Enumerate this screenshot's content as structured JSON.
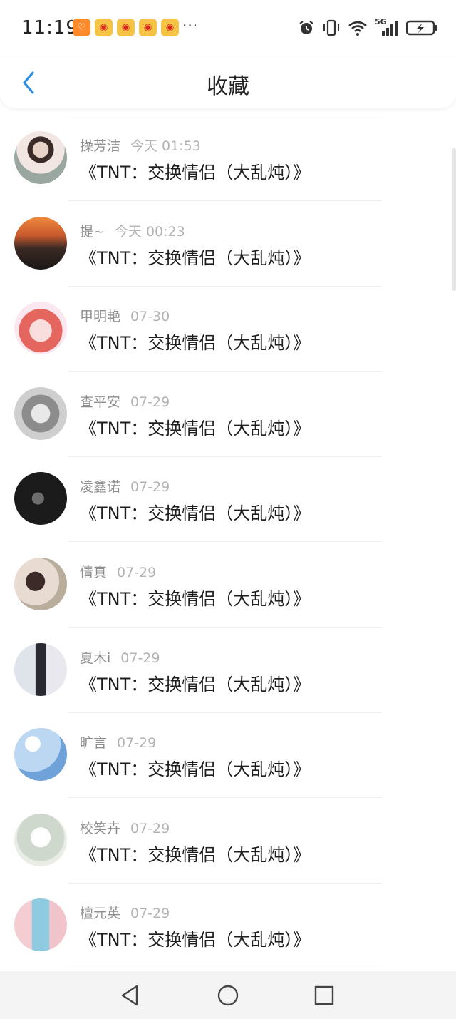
{
  "status_bar": {
    "time": "11:19",
    "network": "5G",
    "apps": [
      "taobao",
      "weibo",
      "weibo",
      "weibo",
      "weibo"
    ],
    "more": "···"
  },
  "header": {
    "title": "收藏",
    "back_icon": "chevron-left-icon",
    "accent_color": "#2b8de6"
  },
  "favorites": [
    {
      "user": "操芳洁",
      "time": "今天 01:53",
      "title": "《TNT：交换情侣（大乱炖）》"
    },
    {
      "user": "提~",
      "time": "今天 00:23",
      "title": "《TNT：交换情侣（大乱炖）》"
    },
    {
      "user": "甲明艳",
      "time": "07-30",
      "title": "《TNT：交换情侣（大乱炖）》"
    },
    {
      "user": "查平安",
      "time": "07-29",
      "title": "《TNT：交换情侣（大乱炖）》"
    },
    {
      "user": "凌鑫诺",
      "time": "07-29",
      "title": "《TNT：交换情侣（大乱炖）》"
    },
    {
      "user": "倩真",
      "time": "07-29",
      "title": "《TNT：交换情侣（大乱炖）》"
    },
    {
      "user": "夏木i",
      "time": "07-29",
      "title": "《TNT：交换情侣（大乱炖）》"
    },
    {
      "user": "旷言",
      "time": "07-29",
      "title": "《TNT：交换情侣（大乱炖）》"
    },
    {
      "user": "校笑卉",
      "time": "07-29",
      "title": "《TNT：交换情侣（大乱炖）》"
    },
    {
      "user": "檀元英",
      "time": "07-29",
      "title": "《TNT：交换情侣（大乱炖）》"
    }
  ],
  "bottom_nav": {
    "back": "triangle-back-icon",
    "home": "circle-home-icon",
    "recents": "square-recents-icon"
  }
}
